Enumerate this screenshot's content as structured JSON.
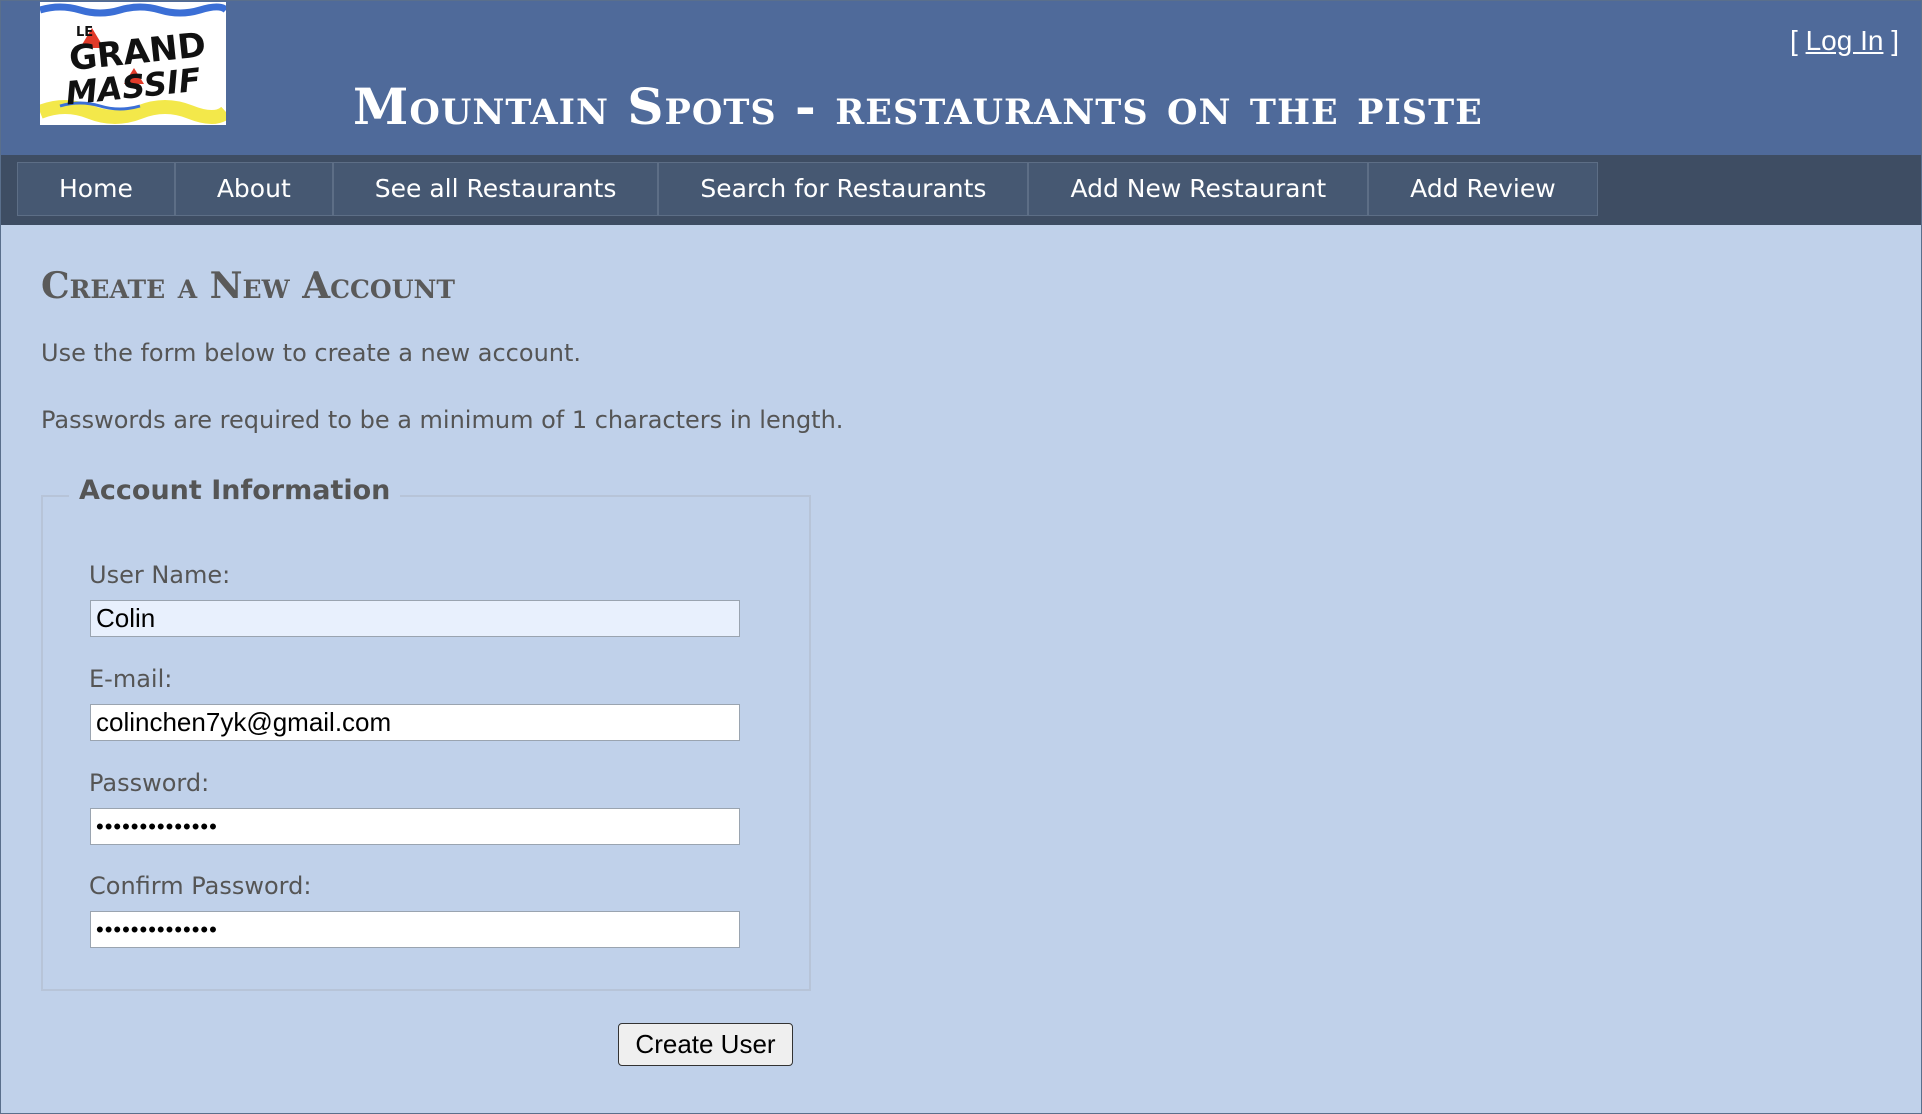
{
  "header": {
    "logo_text": "LE GRAND MASSIF",
    "title": "Mountain Spots  - restaurants on the piste",
    "login_open": "[ ",
    "login_label": "Log In",
    "login_close": " ]"
  },
  "nav": {
    "items": [
      {
        "label": "Home"
      },
      {
        "label": "About"
      },
      {
        "label": "See all Restaurants"
      },
      {
        "label": "Search for Restaurants"
      },
      {
        "label": "Add New Restaurant"
      },
      {
        "label": "Add Review"
      }
    ]
  },
  "main": {
    "title": "Create a New Account",
    "intro": "Use the form below to create a new account.",
    "password_note": "Passwords are required to be a minimum of 1 characters in length.",
    "fieldset_legend": "Account Information",
    "fields": {
      "username": {
        "label": "User Name:",
        "value": "Colin"
      },
      "email": {
        "label": "E-mail:",
        "value": "colinchen7yk@gmail.com"
      },
      "password": {
        "label": "Password:",
        "value": "••••••••••••••"
      },
      "confirm_password": {
        "label": "Confirm Password:",
        "value": "••••••••••••••"
      }
    },
    "submit_label": "Create User"
  },
  "colors": {
    "header_bg": "#4f6a9a",
    "nav_bg": "#3e4d63",
    "page_bg": "#c0d1ea",
    "autofill_bg": "#e8f0fd"
  }
}
